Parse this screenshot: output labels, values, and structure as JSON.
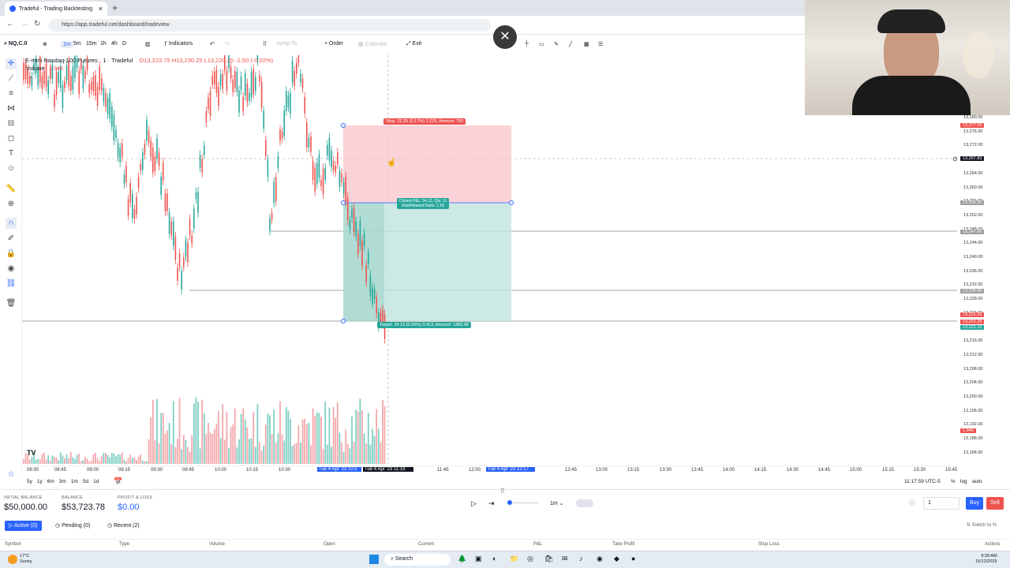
{
  "browser": {
    "tab_title": "Tradeful - Trading Backtesting",
    "url": "https://app.tradeful.net/dashboard/tradeview"
  },
  "toolbar": {
    "symbol": "NQ,C.0",
    "intervals": [
      "1m",
      "5m",
      "15m",
      "1h",
      "4h",
      "D"
    ],
    "indicators_label": "Indicators",
    "jump_to_label": "Jump To",
    "order_label": "Order",
    "calendar_label": "Calendar",
    "exit_label": "Exit"
  },
  "legend": {
    "title": "E-mini Nasdaq-100 Futures · 1 · Tradeful",
    "ohlc": "O13,223.75 H13,230.25 L13,220.25 -2.50 (-0.02%)",
    "volume_label": "Volume",
    "volume_value": "1.94K"
  },
  "position": {
    "stop_label": "Stop: 22.25 (0.17%) 2,225, Amount: 750",
    "pnl_label": "Closed P&L: 34.13, Qty: 11",
    "rr_label": "Risk/Reward Ratio: 1.53",
    "target_label": "Target: 34.13 (0.26%) 3,413, Amount: 1383.48"
  },
  "price_axis": {
    "ticks": [
      "13,280.00",
      "13,276.00",
      "13,272.00",
      "13,268.00",
      "13,264.00",
      "13,260.00",
      "13,256.00",
      "13,252.00",
      "13,248.00",
      "13,244.00",
      "13,240.00",
      "13,236.00",
      "13,232.00",
      "13,228.00",
      "13,224.00",
      "13,220.00",
      "13,216.00",
      "13,212.00",
      "13,208.00",
      "13,204.00",
      "13,200.00",
      "13,196.00",
      "13,192.00",
      "13,188.00",
      "13,184.00"
    ],
    "tags": [
      {
        "text": "13,277.50",
        "color": "#ef5350"
      },
      {
        "text": "13,267.83",
        "color": "#131722"
      },
      {
        "text": "13,255.25",
        "color": "#9e9e9e"
      },
      {
        "text": "13,247.00",
        "color": "#9e9e9e"
      },
      {
        "text": "13,230.00",
        "color": "#9e9e9e"
      },
      {
        "text": "13,221.25",
        "color": "#ef5350"
      },
      {
        "text": "13,221.25",
        "color": "#ef5350"
      },
      {
        "text": "13,221.12",
        "color": "#26a69a"
      },
      {
        "text": "1.94K",
        "color": "#ef5350"
      }
    ]
  },
  "time_axis": {
    "ticks": [
      "08:30",
      "08:45",
      "09:00",
      "09:15",
      "09:30",
      "09:45",
      "10:00",
      "10:15",
      "10:30",
      "11:45",
      "12:00",
      "12:45",
      "13:00",
      "13:15",
      "13:30",
      "13:45",
      "14:00",
      "14:15",
      "14:30",
      "14:45",
      "15:00",
      "15:15",
      "15:30",
      "15:45"
    ],
    "highlight_1": "Tue 4 Apr '23",
    "highlight_1_time": "10:5",
    "highlight_2": "Tue 4 Apr '23",
    "highlight_2_time": "11:19",
    "highlight_3": "Tue 4 Apr '23",
    "highlight_3_time": "12:17"
  },
  "bottom_bar": {
    "ranges": [
      "5y",
      "1y",
      "6m",
      "3m",
      "1m",
      "5d",
      "1d"
    ],
    "clock": "11:17:59 UTC-5",
    "percent": "%",
    "log": "log",
    "auto": "auto"
  },
  "account": {
    "initial_balance_label": "INITIAL BALANCE",
    "initial_balance": "$50,000.00",
    "balance_label": "BALANCE",
    "balance": "$53,723.78",
    "pnl_label": "PROFIT & LOSS",
    "pnl": "$0.00",
    "speed": "1m",
    "qty": "1",
    "buy_label": "Buy",
    "sell_label": "Sell",
    "switch_label": "Switch to %"
  },
  "trade_tabs": {
    "active": "Active (0)",
    "pending": "Pending (0)",
    "recent": "Recent (2)"
  },
  "columns": [
    "Symbol",
    "Type",
    "Volume",
    "Open",
    "Current",
    "P&L",
    "Take Profit",
    "Stop Loss",
    "Actions"
  ],
  "taskbar": {
    "weather_temp": "17°C",
    "weather_desc": "Sunny",
    "search": "Search",
    "time": "9:39 AM",
    "date": "15/12/2025"
  },
  "colors": {
    "accent": "#2962ff",
    "up": "#26a69a",
    "down": "#ef5350",
    "stop_zone": "#f7c4c9",
    "target_zone": "#bfe3dc"
  }
}
